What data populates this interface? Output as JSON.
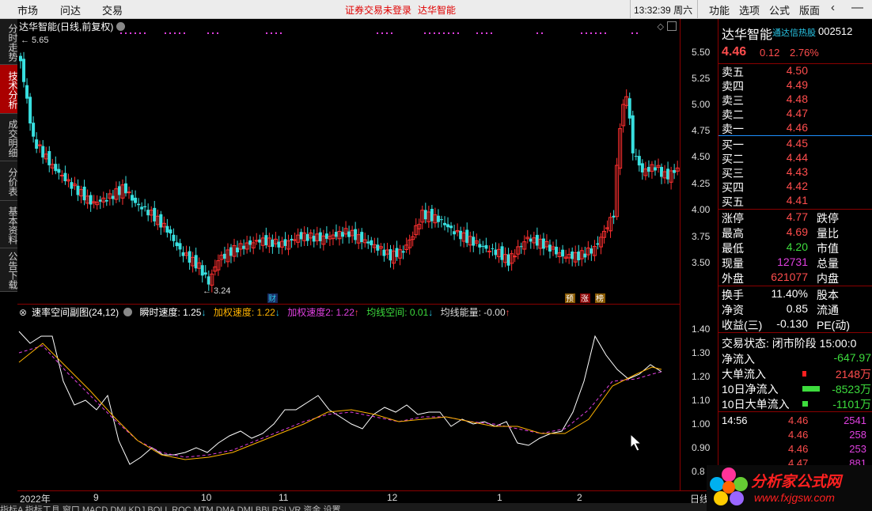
{
  "menu": {
    "items": [
      "市场",
      "问达",
      "交易"
    ],
    "alert": "证券交易未登录",
    "alert_name": "达华智能",
    "clock": "13:32:39",
    "weekday": "周六",
    "right_items": [
      "功能",
      "选项",
      "公式",
      "版面"
    ],
    "win_back": "‹",
    "win_min": "—"
  },
  "vtabs": [
    "分时走势",
    "技术分析",
    "成交明细",
    "分价表",
    "基本资料",
    "公告下载"
  ],
  "chart": {
    "header": "达华智能(日线,前复权)",
    "max_label": "← 5.65",
    "min_label": "← 3.24",
    "price_ticks": [
      "5.50",
      "5.25",
      "5.00",
      "4.75",
      "4.50",
      "4.25",
      "4.00",
      "3.75",
      "3.50"
    ],
    "event_tags": {
      "cai": "财",
      "yu": "预",
      "zhang": "涨",
      "bang": "榜"
    },
    "indicator": {
      "name": "速率空间副图(24,12)",
      "v1_label": "瞬时速度: 1.25",
      "v1_arrow": "↓",
      "v2_label": "加权速度: 1.22",
      "v2_arrow": "↓",
      "v3_label": "加权速度2: 1.22",
      "v3_arrow": "↑",
      "v4_label": "均线空间: 0.01",
      "v4_arrow": "↓",
      "v5_label": "均线能量: -0.00",
      "v5_arrow": "↑",
      "ticks": [
        "1.40",
        "1.30",
        "1.20",
        "1.10",
        "1.00",
        "0.90",
        "0.8"
      ]
    },
    "dates": [
      "2022年",
      "9",
      "10",
      "11",
      "12",
      "1",
      "2"
    ],
    "date_right": "日线"
  },
  "bottom_tabs": "指标A  指标工具  窗口  MACD  DMI  KDJ  BOLL  ROC  MTM  DMA  DMI  BBI  RSI  VR  资金  设置",
  "quote": {
    "name": "达华智能",
    "hot": "通达信热股",
    "code": "002512",
    "price": "4.46",
    "change": "0.12",
    "pct": "2.76%",
    "asks": [
      {
        "label": "卖五",
        "price": "4.50"
      },
      {
        "label": "卖四",
        "price": "4.49"
      },
      {
        "label": "卖三",
        "price": "4.48"
      },
      {
        "label": "卖二",
        "price": "4.47"
      },
      {
        "label": "卖一",
        "price": "4.46"
      }
    ],
    "bids": [
      {
        "label": "买一",
        "price": "4.45"
      },
      {
        "label": "买二",
        "price": "4.44"
      },
      {
        "label": "买三",
        "price": "4.43"
      },
      {
        "label": "买四",
        "price": "4.42"
      },
      {
        "label": "买五",
        "price": "4.41"
      }
    ],
    "stats": [
      {
        "l1": "涨停",
        "v1": "4.77",
        "c": "red",
        "l2": "跌停"
      },
      {
        "l1": "最高",
        "v1": "4.69",
        "c": "red",
        "l2": "量比"
      },
      {
        "l1": "最低",
        "v1": "4.20",
        "c": "green",
        "l2": "市值"
      },
      {
        "l1": "现量",
        "v1": "12731",
        "c": "mag",
        "l2": "总量"
      },
      {
        "l1": "外盘",
        "v1": "621077",
        "c": "red",
        "l2": "内盘"
      }
    ],
    "stats2": [
      {
        "l1": "换手",
        "v1": "11.40%",
        "c": "white",
        "l2": "股本"
      },
      {
        "l1": "净资",
        "v1": "0.85",
        "c": "white",
        "l2": "流通"
      },
      {
        "l1": "收益(三)",
        "v1": "-0.130",
        "c": "white",
        "l2": "PE(动)"
      }
    ],
    "status": "交易状态: 闭市阶段 15:00:0",
    "flows": [
      {
        "label": "净流入",
        "value": "-647.97",
        "c": "green"
      },
      {
        "label": "大单流入",
        "value": "2148万",
        "c": "red"
      },
      {
        "label": "10日净流入",
        "value": "-8523万",
        "c": "green"
      },
      {
        "label": "10日大单流入",
        "value": "-1101万",
        "c": "green"
      }
    ],
    "ticks": [
      {
        "time": "14:56",
        "price": "4.46",
        "vol": "2541"
      },
      {
        "time": "",
        "price": "4.46",
        "vol": "258"
      },
      {
        "time": "",
        "price": "4.46",
        "vol": "253"
      },
      {
        "time": "",
        "price": "4.47",
        "vol": "881"
      }
    ]
  },
  "logo": {
    "title": "分析家公式网",
    "url": "www.fxjgsw.com"
  }
}
